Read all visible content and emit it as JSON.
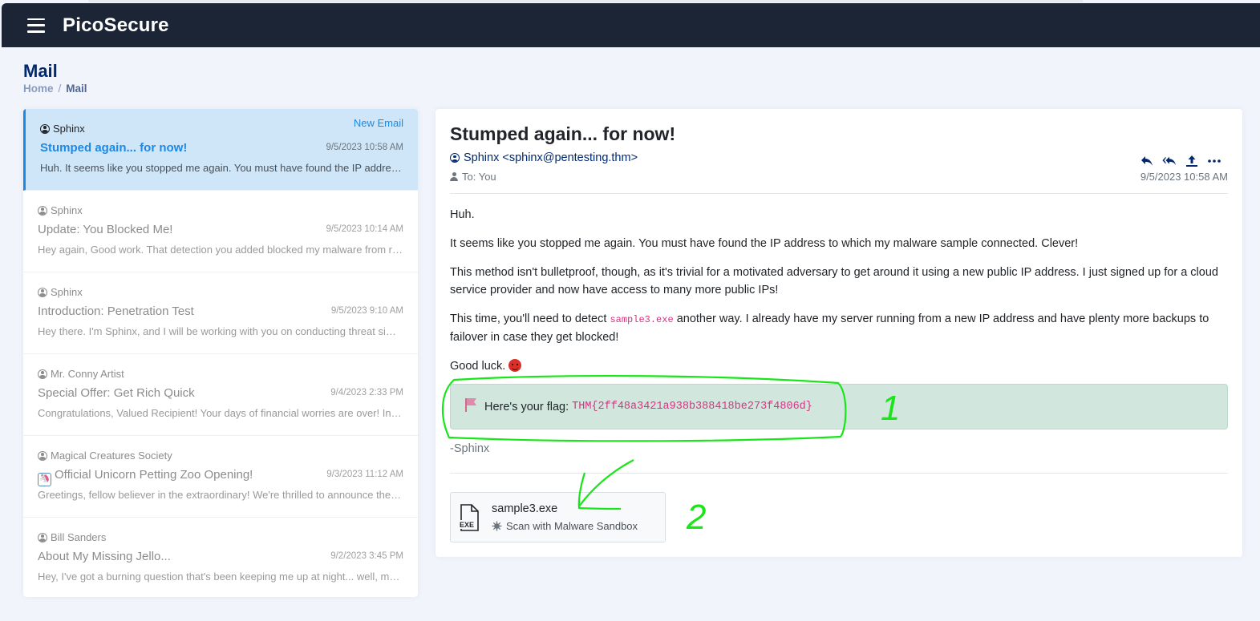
{
  "app": {
    "brand": "PicoSecure"
  },
  "page": {
    "title": "Mail"
  },
  "breadcrumb": {
    "home": "Home",
    "separator": "/",
    "current": "Mail"
  },
  "mail_list": {
    "new_email_label": "New Email",
    "items": [
      {
        "sender": "Sphinx",
        "subject": "Stumped again... for now!",
        "date": "9/5/2023 10:58 AM",
        "preview": "Huh. It seems like you stopped me again. You must have found the IP address to which my malware sample connected. Clever!",
        "active": true
      },
      {
        "sender": "Sphinx",
        "subject": "Update: You Blocked Me!",
        "date": "9/5/2023 10:14 AM",
        "preview": "Hey again, Good work. That detection you added blocked my malware from running on your systems."
      },
      {
        "sender": "Sphinx",
        "subject": "Introduction: Penetration Test",
        "date": "9/5/2023 9:10 AM",
        "preview": "Hey there. I'm Sphinx, and I will be working with you on conducting threat simulations."
      },
      {
        "sender": "Mr. Conny Artist",
        "subject": "Special Offer: Get Rich Quick",
        "date": "9/4/2023 2:33 PM",
        "preview": "Congratulations, Valued Recipient! Your days of financial worries are over! In a world of uncertainty"
      },
      {
        "sender": "Magical Creatures Society",
        "subject": "Official Unicorn Petting Zoo Opening!",
        "date": "9/3/2023 11:12 AM",
        "preview": "Greetings, fellow believer in the extraordinary! We're thrilled to announce the grand opening",
        "icon": "unicorn-icon"
      },
      {
        "sender": "Bill Sanders",
        "subject": "About My Missing Jello...",
        "date": "9/2/2023 3:45 PM",
        "preview": "Hey, I've got a burning question that's been keeping me up at night... well, more like in the afternoon"
      }
    ]
  },
  "email": {
    "subject": "Stumped again... for now!",
    "from": "Sphinx <sphinx@pentesting.thm>",
    "to": "To: You",
    "date": "9/5/2023 10:58 AM",
    "actions": [
      "reply-icon",
      "reply-all-icon",
      "forward-icon",
      "more-icon"
    ],
    "body": {
      "p1": "Huh.",
      "p2": "It seems like you stopped me again. You must have found the IP address to which my malware sample connected. Clever!",
      "p3": "This method isn't bulletproof, though, as it's trivial for a motivated adversary to get around it using a new public IP address. I just signed up for a cloud service provider and now have access to many more public IPs!",
      "p4_before": "This time, you'll need to detect",
      "p4_code": "sample3.exe",
      "p4_after": "another way. I already have my server running from a new IP address and have plenty more backups to failover in case they get blocked!",
      "p5": "Good luck."
    },
    "flag": {
      "label": "Here's your flag:",
      "value": "THM{2ff48a3421a938b388418be273f4806d}"
    },
    "signature": "-Sphinx",
    "attachment": {
      "name": "sample3.exe",
      "icon_text": "EXE",
      "scan_label": "Scan with Malware Sandbox"
    }
  },
  "annotations": {
    "labels": [
      "1",
      "2"
    ],
    "color": "#19e619"
  },
  "colors": {
    "navbar": "#1b2535",
    "accent": "#1e88e5",
    "title": "#012970",
    "flag_bg": "#d1e7dd",
    "code": "#d63384"
  }
}
